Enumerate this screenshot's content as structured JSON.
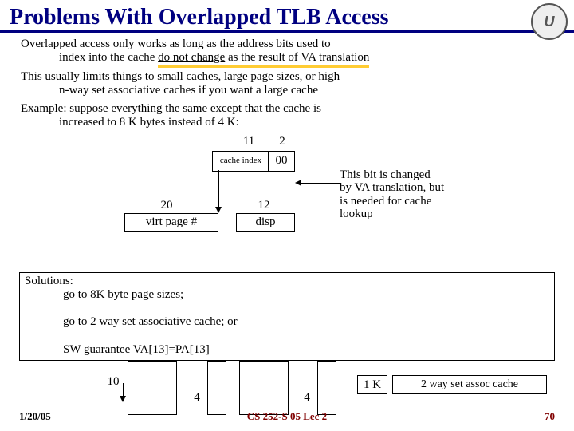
{
  "title": "Problems With Overlapped TLB Access",
  "para1_a": "Overlapped access only works as long as the address bits used to",
  "para1_b": "index into the cache ",
  "do_not_change": "do not change",
  "para1_c": "  as the result of VA translation",
  "para2_a": "This usually limits things to small caches, large page sizes, or high",
  "para2_b": "n-way set associative caches if you want a large cache",
  "para3_a": "Example:  suppose everything the same except that the cache is",
  "para3_b": "increased to 8 K bytes instead of 4 K:",
  "d1": {
    "n11": "11",
    "n2": "2",
    "cache_index": "cache index",
    "zerozero": "00",
    "n20": "20",
    "virt_page": "virt page #",
    "n12": "12",
    "disp": "disp"
  },
  "note_a": "This bit is changed",
  "note_b": "by VA translation, but",
  "note_c": "is needed for cache",
  "note_d": "lookup",
  "solutions_hdr": "Solutions:",
  "sol1": "go to 8K byte page sizes;",
  "sol2": "go to 2 way set associative cache; or",
  "sol3": "SW guarantee VA[13]=PA[13]",
  "d2": {
    "n10": "10",
    "n4a": "4",
    "n4b": "4",
    "n1k": "1 K",
    "assoc": "2 way set assoc cache"
  },
  "footer": {
    "date": "1/20/05",
    "center": "CS 252-S 05 Lec 2",
    "num": "70"
  }
}
